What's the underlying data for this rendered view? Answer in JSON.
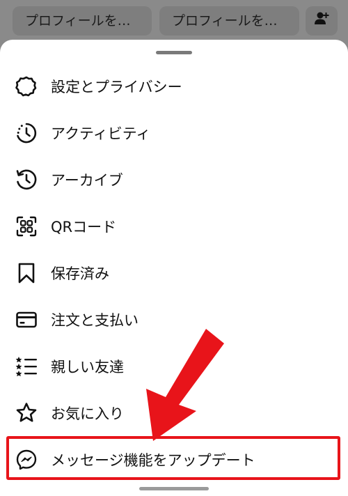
{
  "topbar": {
    "buttons": [
      {
        "label": "プロフィールを…"
      },
      {
        "label": "プロフィールを…"
      }
    ],
    "add_person_icon": "person-add-icon"
  },
  "menu": {
    "items": [
      {
        "label": "設定とプライバシー",
        "icon": "settings-gear-icon"
      },
      {
        "label": "アクティビティ",
        "icon": "activity-clock-icon"
      },
      {
        "label": "アーカイブ",
        "icon": "archive-history-icon"
      },
      {
        "label": "QRコード",
        "icon": "qr-code-icon"
      },
      {
        "label": "保存済み",
        "icon": "bookmark-icon"
      },
      {
        "label": "注文と支払い",
        "icon": "credit-card-icon"
      },
      {
        "label": "親しい友達",
        "icon": "close-friends-list-icon"
      },
      {
        "label": "お気に入り",
        "icon": "star-icon"
      },
      {
        "label": "メッセージ機能をアップデート",
        "icon": "messenger-icon"
      }
    ]
  },
  "colors": {
    "highlight": "#e8141a",
    "dim_background": "#8a8a8a",
    "sheet": "#ffffff",
    "text": "#111111"
  }
}
